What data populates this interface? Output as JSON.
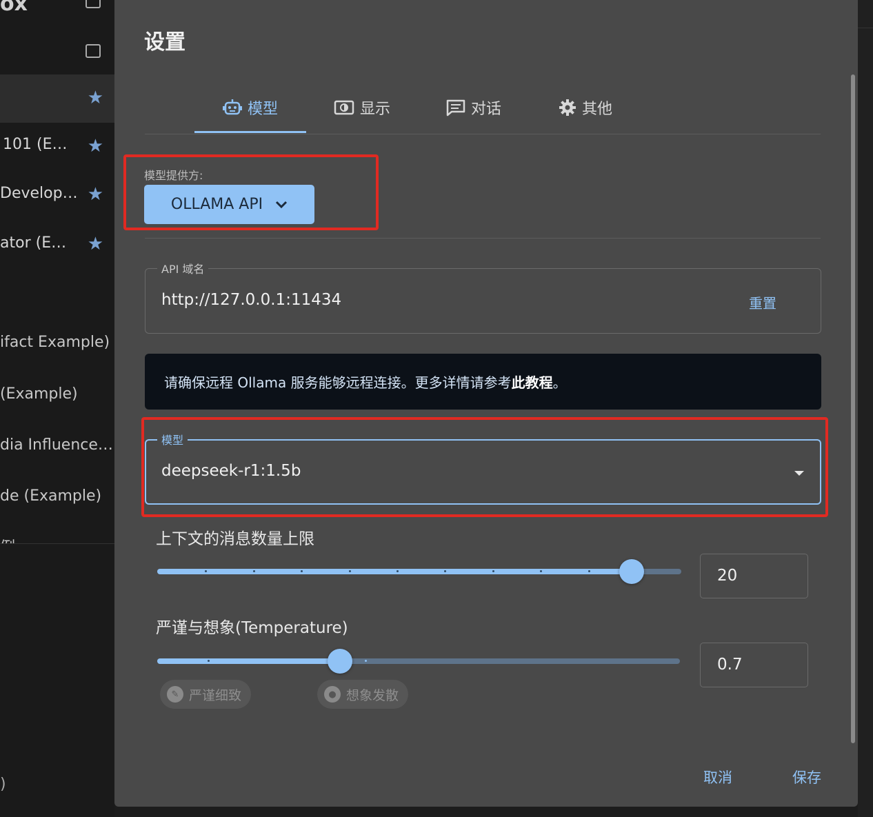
{
  "background": {
    "sidebar_top_text": "ox",
    "sidebar_items": [
      {
        "label": "",
        "active": true
      },
      {
        "label": "101 (E…",
        "active": false
      },
      {
        "label": "Develop…",
        "active": false
      },
      {
        "label": "ator (E…",
        "active": false
      }
    ],
    "list_items": [
      "ifact Example)",
      "(Example)",
      "dia Influence…",
      "de (Example)",
      "例"
    ],
    "bottom_text": ")"
  },
  "dialog": {
    "title": "设置",
    "tabs": [
      {
        "label": "模型",
        "icon": "robot-icon",
        "active": true
      },
      {
        "label": "显示",
        "icon": "display-icon",
        "active": false
      },
      {
        "label": "对话",
        "icon": "chat-icon",
        "active": false
      },
      {
        "label": "其他",
        "icon": "gear-icon",
        "active": false
      }
    ],
    "provider": {
      "label": "模型提供方:",
      "value": "OLLAMA API"
    },
    "api_host": {
      "label": "API 域名",
      "value": "http://127.0.0.1:11434",
      "reset_label": "重置"
    },
    "notice": {
      "text": "请确保远程 Ollama 服务能够远程连接。更多详情请参考",
      "link": "此教程",
      "suffix": "。"
    },
    "model": {
      "label": "模型",
      "value": "deepseek-r1:1.5b"
    },
    "context_limit": {
      "title": "上下文的消息数量上限",
      "value": "20",
      "fraction": 0.905
    },
    "temperature": {
      "title": "严谨与想象(Temperature)",
      "value": "0.7",
      "fraction": 0.35,
      "chip_rigorous": "严谨细致",
      "chip_imaginative": "想象发散"
    },
    "cancel_label": "取消",
    "save_label": "保存"
  },
  "colors": {
    "accent": "#90c2f5",
    "dialog_bg": "#494949",
    "highlight_box": "#e12a22"
  }
}
